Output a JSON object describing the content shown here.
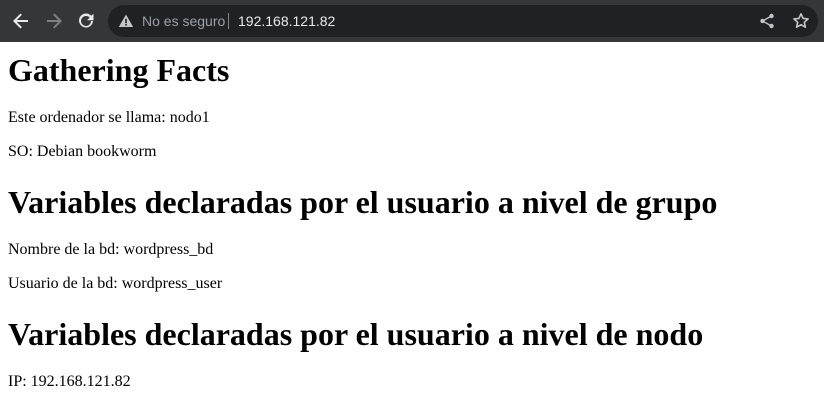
{
  "browser": {
    "security_label": "No es seguro",
    "url": "192.168.121.82",
    "icons": {
      "back": "arrow-left-icon",
      "forward": "arrow-right-icon",
      "reload": "reload-icon",
      "warning": "warning-triangle-icon",
      "share": "share-icon",
      "bookmark": "star-icon"
    }
  },
  "page": {
    "title": "Gathering Facts",
    "hostname_line": "Este ordenador se llama: nodo1",
    "os_line": "SO: Debian bookworm",
    "group_heading": "Variables declaradas por el usuario a nivel de grupo",
    "db_name_line": "Nombre de la bd: wordpress_bd",
    "db_user_line": "Usuario de la bd: wordpress_user",
    "node_heading": "Variables declaradas por el usuario a nivel de nodo",
    "ip_line": "IP: 192.168.121.82"
  }
}
